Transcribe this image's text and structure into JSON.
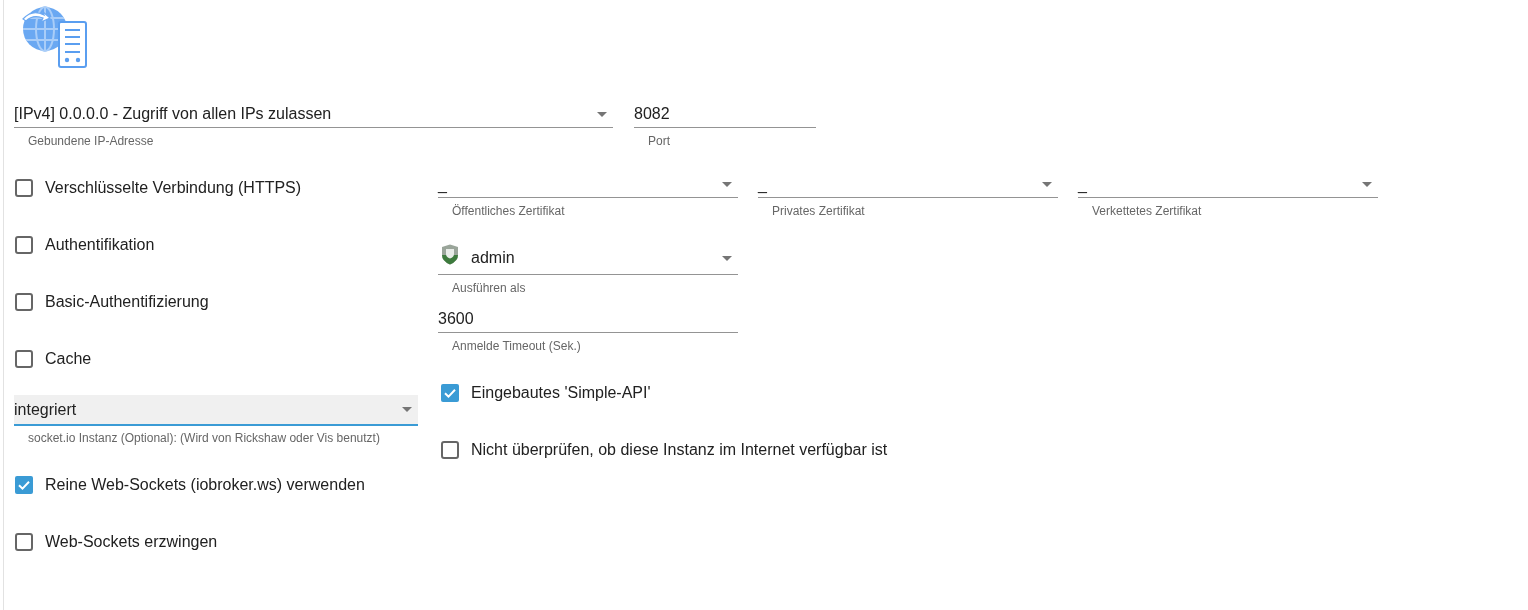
{
  "bind_address": {
    "value": "[IPv4] 0.0.0.0 - Zugriff von allen IPs zulassen",
    "helper": "Gebundene IP-Adresse"
  },
  "port": {
    "value": "8082",
    "helper": "Port"
  },
  "left_options": [
    {
      "kind": "checkbox",
      "label": "Verschlüsselte Verbindung (HTTPS)",
      "checked": false
    },
    {
      "kind": "checkbox",
      "label": "Authentifikation",
      "checked": false
    },
    {
      "kind": "checkbox",
      "label": "Basic-Authentifizierung",
      "checked": false
    },
    {
      "kind": "checkbox",
      "label": "Cache",
      "checked": false
    },
    {
      "kind": "select",
      "value": "integriert",
      "helper": "socket.io Instanz (Optional): (Wird von Rickshaw oder Vis benutzt)",
      "focused": true
    },
    {
      "kind": "checkbox",
      "label": "Reine Web-Sockets (iobroker.ws) verwenden",
      "checked": true
    },
    {
      "kind": "checkbox",
      "label": "Web-Sockets erzwingen",
      "checked": false
    }
  ],
  "certificates": [
    {
      "value": "_",
      "helper": "Öffentliches Zertifikat"
    },
    {
      "value": "_",
      "helper": "Privates Zertifikat"
    },
    {
      "value": "_",
      "helper": "Verkettetes Zertifikat"
    }
  ],
  "run_as": {
    "value": "admin",
    "helper": "Ausführen als"
  },
  "login_timeout": {
    "value": "3600",
    "helper": "Anmelde Timeout (Sek.)"
  },
  "right_options": [
    {
      "label": "Eingebautes 'Simple-API'",
      "checked": true
    },
    {
      "label": "Nicht überprüfen, ob diese Instanz im Internet verfügbar ist",
      "checked": false
    }
  ]
}
